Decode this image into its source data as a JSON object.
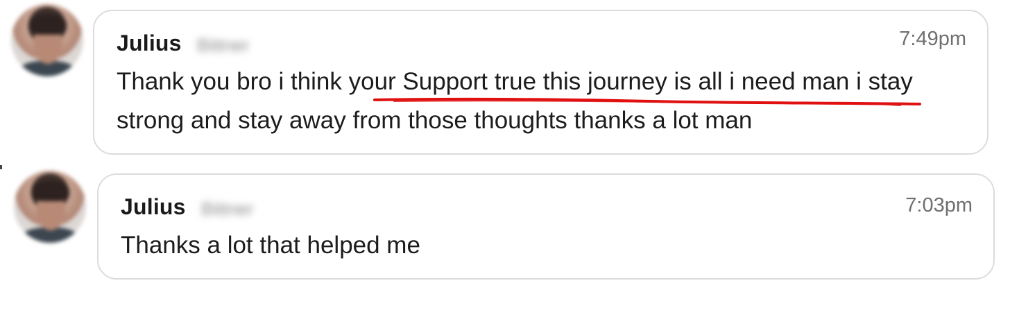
{
  "messages": [
    {
      "sender_first": "Julius",
      "sender_last": "Bittner",
      "time": "7:49pm",
      "text": "Thank you bro i think your Support true this journey is all i need man i stay strong and stay away from those thoughts thanks a lot man",
      "avatar_icon": "user-avatar-icon"
    },
    {
      "sender_first": "Julius",
      "sender_last": "Bittner",
      "time": "7:03pm",
      "text": "Thanks a lot that helped me",
      "avatar_icon": "user-avatar-icon"
    }
  ],
  "annotation": {
    "underline_color": "#e01010"
  },
  "colors": {
    "bubble_border": "#dcdcdc",
    "text": "#1c1c1c",
    "timestamp": "#6f6f6f"
  }
}
